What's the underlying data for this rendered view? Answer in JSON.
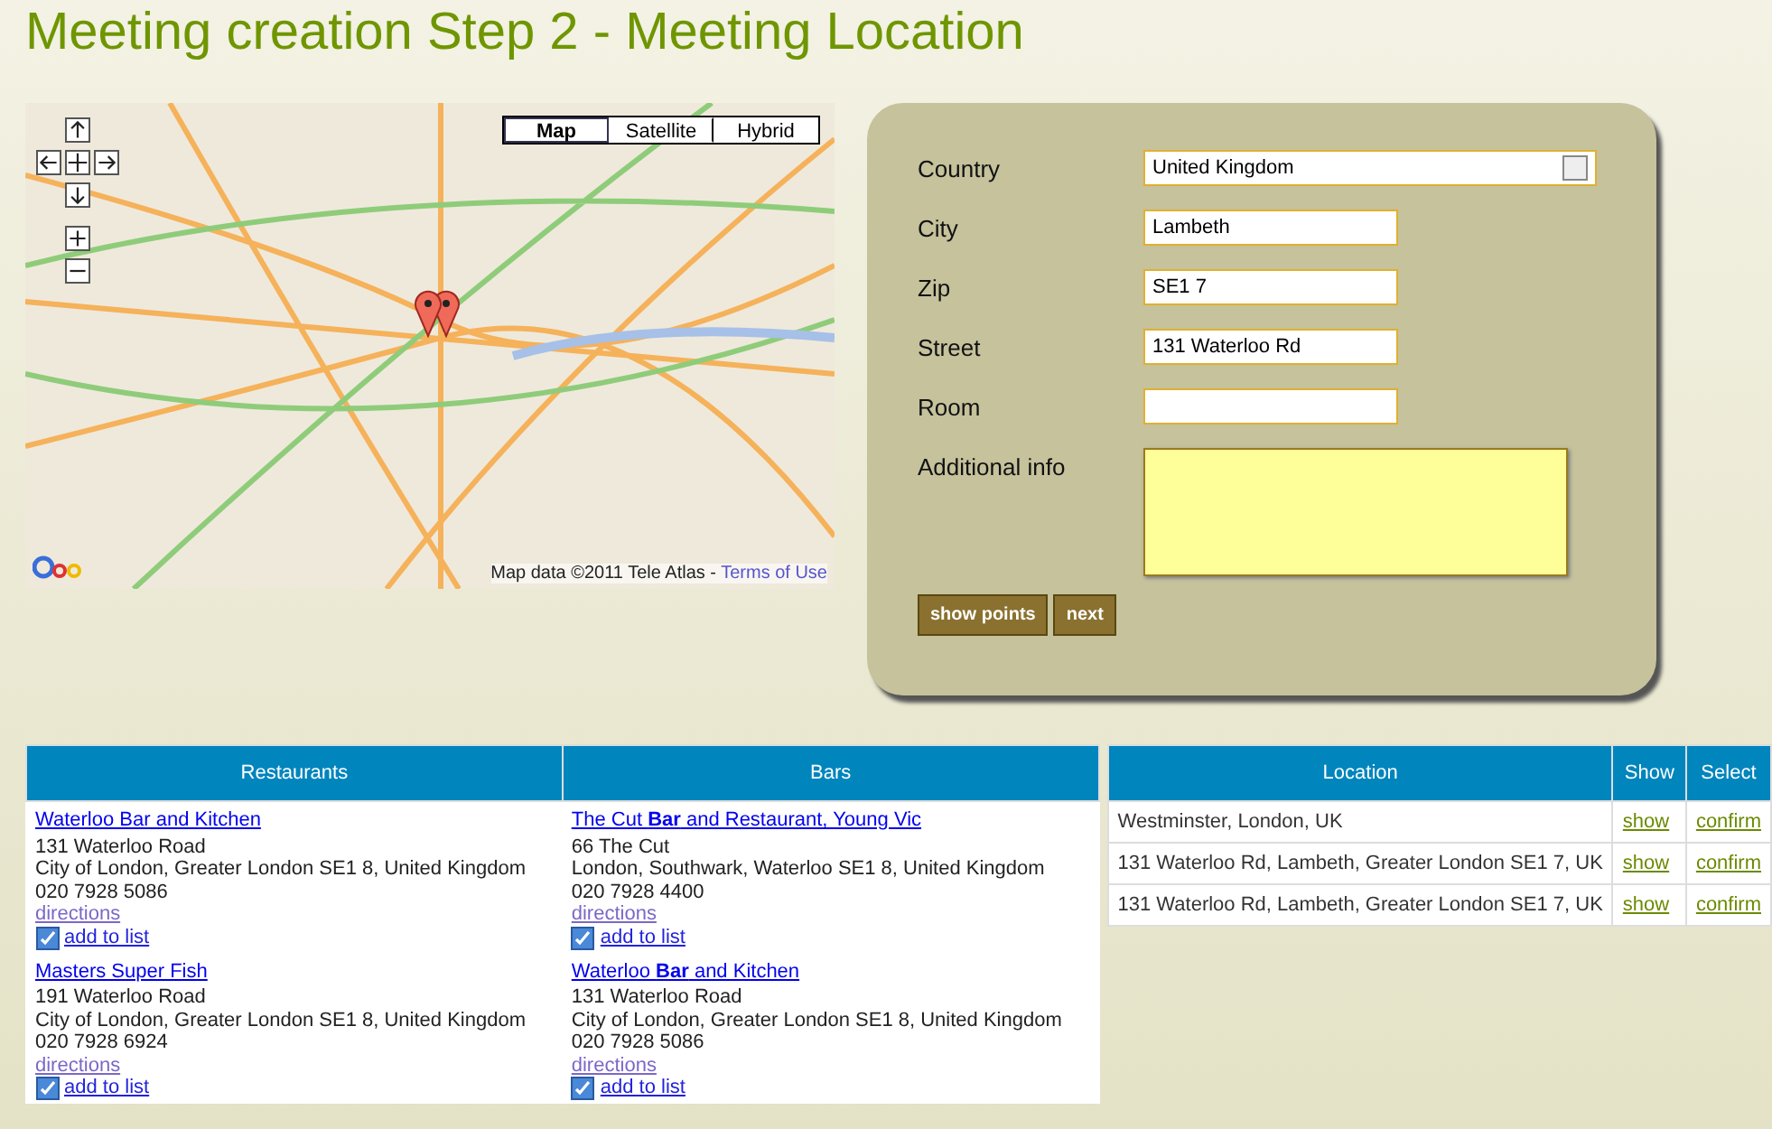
{
  "title": "Meeting creation Step 2 - Meeting Location",
  "map": {
    "types": [
      {
        "label": "Map",
        "selected": true
      },
      {
        "label": "Satellite",
        "selected": false
      },
      {
        "label": "Hybrid",
        "selected": false
      }
    ],
    "attribution": "Map data ©2011 Tele Atlas - ",
    "terms_link": "Terms of Use"
  },
  "form": {
    "fields": [
      {
        "kind": "select",
        "label": "Country",
        "value": "United Kingdom"
      },
      {
        "kind": "text",
        "label": "City",
        "value": "Lambeth"
      },
      {
        "kind": "text",
        "label": "Zip",
        "value": "SE1 7"
      },
      {
        "kind": "text",
        "label": "Street",
        "value": "131 Waterloo Rd"
      },
      {
        "kind": "text",
        "label": "Room"
      },
      {
        "kind": "textarea",
        "label": "Additional info"
      }
    ],
    "buttons": [
      "show points",
      "next"
    ]
  },
  "places": {
    "columns": [
      "Restaurants",
      "Bars"
    ],
    "rows": [
      [
        {
          "name": "Waterloo Bar and Kitchen",
          "lines": [
            "131 Waterloo Road",
            "City of London, Greater London SE1 8, United Kingdom",
            "020 7928 5086"
          ],
          "directions": "directions",
          "add": "add to list",
          "checked": true
        },
        {
          "name": "The Cut **Bar** and Restaurant, Young Vic",
          "lines": [
            "66 The Cut",
            "London, Southwark, Waterloo SE1 8, United Kingdom",
            "020 7928 4400"
          ],
          "directions": "directions",
          "add": "add to list",
          "checked": true
        }
      ],
      [
        {
          "name": "Masters Super Fish",
          "lines": [
            "191 Waterloo Road",
            "City of London, Greater London SE1 8, United Kingdom",
            "020 7928 6924"
          ],
          "directions": "directions",
          "add": "add to list",
          "checked": true
        },
        {
          "name": "Waterloo **Bar** and Kitchen",
          "lines": [
            "131 Waterloo Road",
            "City of London, Greater London SE1 8, United Kingdom",
            "020 7928 5086"
          ],
          "directions": "directions",
          "add": "add to list",
          "checked": true
        }
      ]
    ]
  },
  "locations": {
    "columns": [
      "Location",
      "Show",
      "Select"
    ],
    "rows": [
      {
        "location": "Westminster, London, UK",
        "show": "show",
        "select": "confirm"
      },
      {
        "location": "131 Waterloo Rd, Lambeth, Greater London SE1 7, UK",
        "show": "show",
        "select": "confirm"
      },
      {
        "location": "131 Waterloo Rd, Lambeth, Greater London SE1 7, UK",
        "show": "show",
        "select": "confirm"
      }
    ]
  }
}
